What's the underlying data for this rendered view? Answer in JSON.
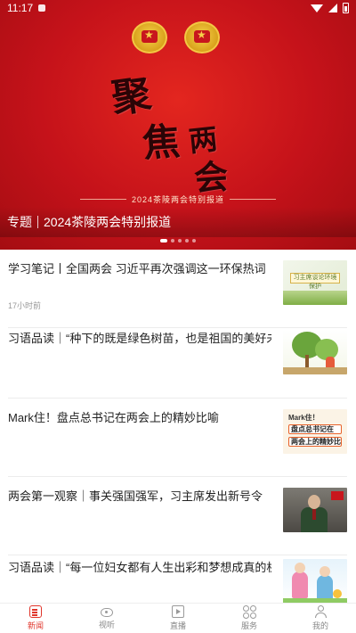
{
  "status_bar": {
    "time": "11:17"
  },
  "banner": {
    "calligraphy": [
      "聚",
      "焦",
      "两",
      "会"
    ],
    "ribbon_text": "2024茶陵两会特别报道",
    "caption_prefix": "专题",
    "caption_title": "2024茶陵两会特别报道",
    "slide_count": 5,
    "active_slide": 1
  },
  "news": [
    {
      "title": "学习笔记丨全国两会 习近平再次强调这一环保热词",
      "time": "17小时前",
      "thumb_text": "习主席谈论环境保护"
    },
    {
      "title": "习语品读｜“种下的既是绿色树苗，也是祖国的美好未来”",
      "time": ""
    },
    {
      "title": "Mark住！盘点总书记在两会上的精妙比喻",
      "time": "",
      "thumb_text": [
        "Mark住！",
        "盘点总书记在",
        "两会上的精妙比喻"
      ]
    },
    {
      "title": "两会第一观察｜事关强国强军，习主席发出新号令",
      "time": ""
    },
    {
      "title": "习语品读｜“每一位妇女都有人生出彩和梦想成真的机会”",
      "time": ""
    }
  ],
  "bottom_nav": {
    "items": [
      {
        "label": "新闻",
        "icon": "news-icon",
        "active": true
      },
      {
        "label": "视听",
        "icon": "eye-icon",
        "active": false
      },
      {
        "label": "直播",
        "icon": "live-icon",
        "active": false
      },
      {
        "label": "服务",
        "icon": "grid-icon",
        "active": false
      },
      {
        "label": "我的",
        "icon": "user-icon",
        "active": false
      }
    ]
  },
  "colors": {
    "banner_red": "#c5121a",
    "accent": "#e0352b"
  }
}
